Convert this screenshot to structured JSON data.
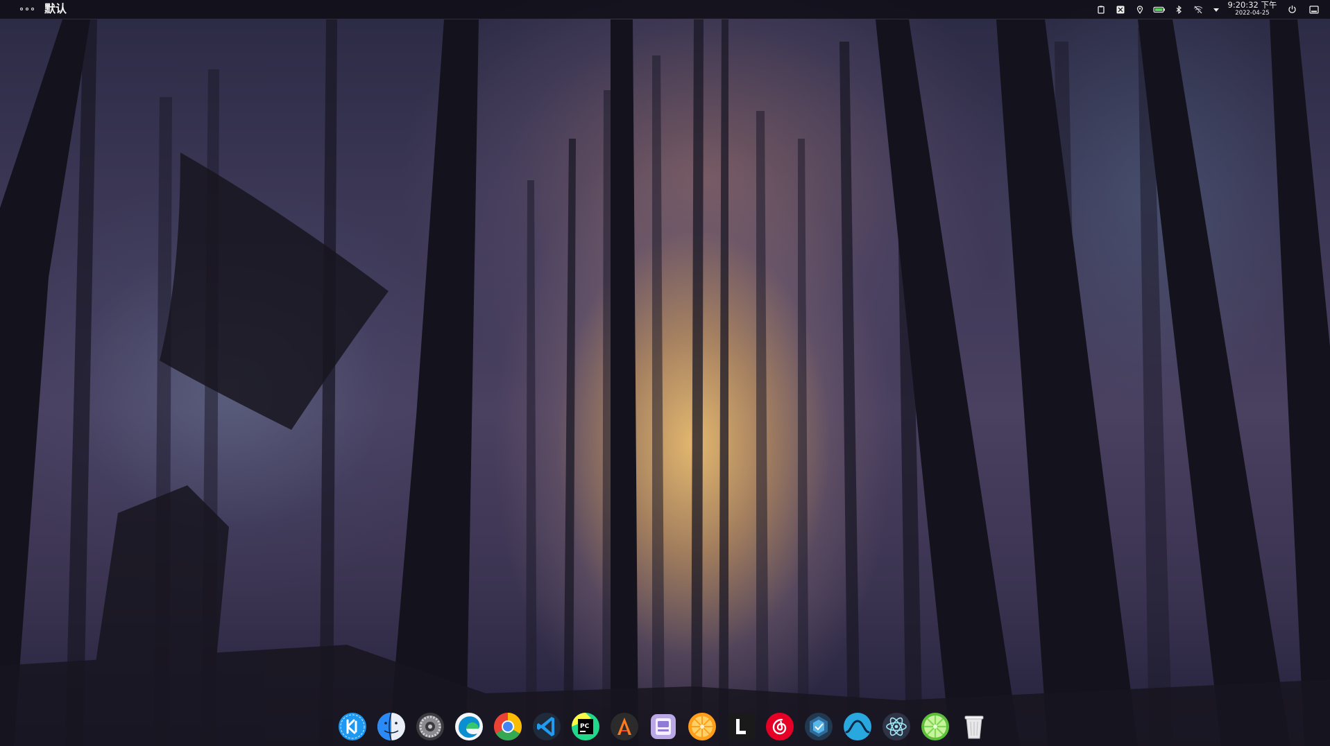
{
  "topbar": {
    "menu_icon": "dots-menu-icon",
    "app_title": "默认",
    "tray_icons": [
      "clipboard-icon",
      "input-method-icon",
      "location-icon",
      "battery-icon",
      "bluetooth-icon",
      "network-disabled-icon",
      "dropdown-arrow-icon"
    ],
    "clock": {
      "time": "9:20:32 下午",
      "date": "2022-04-25"
    },
    "power_icon": "power-icon",
    "show_desktop_icon": "show-desktop-icon"
  },
  "dock": {
    "apps": [
      {
        "name": "KDE Plasma launcher",
        "icon": "kde-icon",
        "color": "#1d99f3"
      },
      {
        "name": "Finder",
        "icon": "finder-icon",
        "color": "#2a8af6"
      },
      {
        "name": "System Settings",
        "icon": "system-settings-icon",
        "color": "#6b6b6b"
      },
      {
        "name": "Microsoft Edge",
        "icon": "edge-icon",
        "color": "#0c9fd8"
      },
      {
        "name": "Google Chrome",
        "icon": "chrome-icon",
        "color": "#ea4335"
      },
      {
        "name": "Visual Studio Code",
        "icon": "vscode-icon",
        "color": "#1f9cf0"
      },
      {
        "name": "PyCharm",
        "icon": "pycharm-icon",
        "color": "#21d789"
      },
      {
        "name": "Arch Linux Tool",
        "icon": "arch-a-icon",
        "color": "#2b2b2b"
      },
      {
        "name": "File Manager",
        "icon": "file-manager-icon",
        "color": "#b9a7e6"
      },
      {
        "name": "Orange App",
        "icon": "orange-icon",
        "color": "#ff9e1b"
      },
      {
        "name": "Typora",
        "icon": "typora-l-icon",
        "color": "#1a1a1a"
      },
      {
        "name": "NetEase Cloud Music",
        "icon": "netease-music-icon",
        "color": "#e60026"
      },
      {
        "name": "Sky Blue App",
        "icon": "hexagon-app-icon",
        "color": "#2f6b9a"
      },
      {
        "name": "Wave App",
        "icon": "wave-icon",
        "color": "#29a8e0"
      },
      {
        "name": "Electron App",
        "icon": "electron-icon",
        "color": "#2e3446"
      },
      {
        "name": "Lime App",
        "icon": "lime-icon",
        "color": "#7ed957"
      },
      {
        "name": "Trash",
        "icon": "trash-icon",
        "color": "#e8e8e8"
      }
    ]
  }
}
